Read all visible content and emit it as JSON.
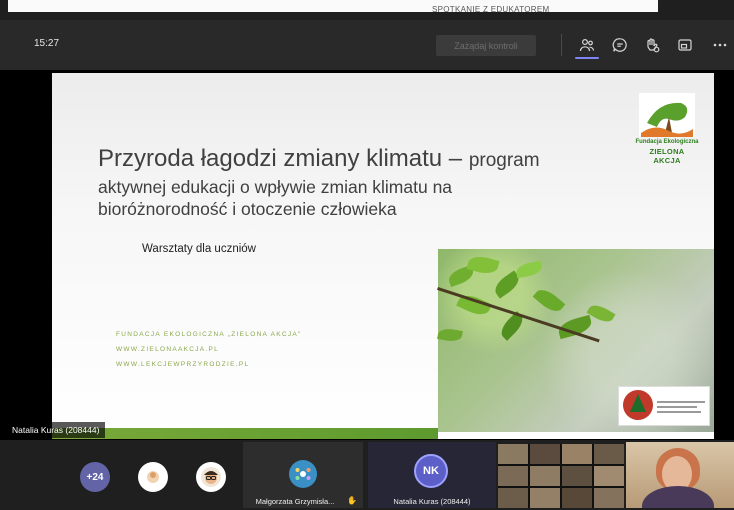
{
  "window": {
    "banner_title": "SPOTKANIE Z EDUKATOREM"
  },
  "toolbar": {
    "time": "15:27",
    "request_control_label": "Zażądaj kontroli",
    "icons": [
      "people-icon",
      "chat-icon",
      "reactions-icon",
      "share-tray-icon",
      "more-icon"
    ],
    "accent_color": "#7f85f5"
  },
  "slide": {
    "logo_line1": "Fundacja Ekologiczna",
    "logo_line2": "ZIELONA AKCJA",
    "title_main": "Przyroda łagodzi zmiany klimatu",
    "title_dash": " – ",
    "title_program": "program",
    "title_line2": "aktywnej edukacji o wpływie zmian klimatu na",
    "title_line3": "bioróżnorodność i otoczenie człowieka",
    "subtitle": "Warsztaty dla uczniów",
    "footer_org": "FUNDACJA EKOLOGICZNA „ZIELONA AKCJA\"",
    "footer_link1": "WWW.ZIELONAAKCJA.PL",
    "footer_link2": "WWW.LEKCJEWPRZYRODZIE.PL",
    "accent_green": "#6aa232"
  },
  "presenter_tag": "Natalia Kuras (208444)",
  "participants": {
    "overflow_count": "+24",
    "tile_1_name": "Małgorzata Grzymisła...",
    "tile_2_name": "Natalia Kuras (208444)",
    "tile_2_initials": "NK"
  }
}
